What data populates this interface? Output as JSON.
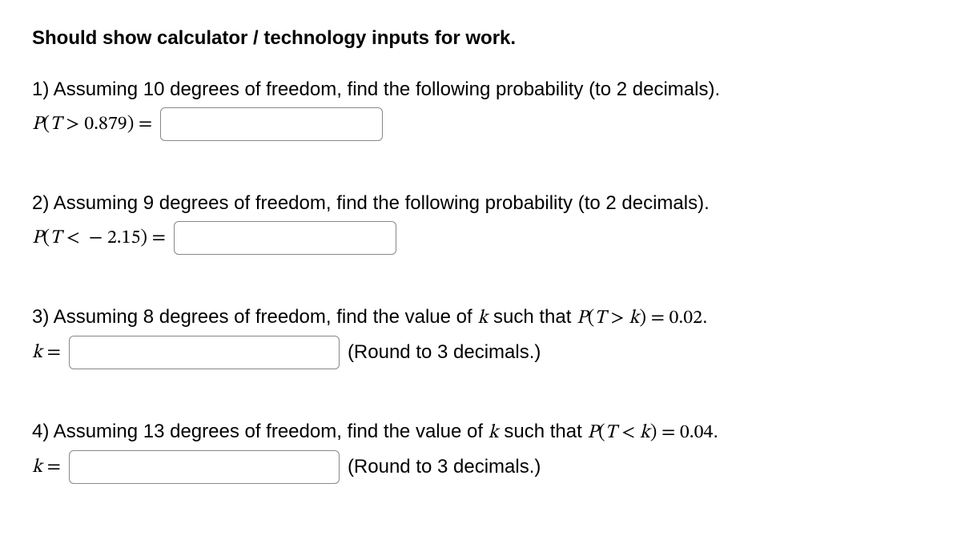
{
  "heading": "Should show calculator / technology inputs for work.",
  "q1": {
    "prompt_prefix": "1) Assuming 10 degrees of freedom, find the following probability (to 2 decimals).",
    "expr_P": "P",
    "expr_open": "(",
    "expr_T": "T",
    "expr_op": ">",
    "expr_val": "0.879",
    "expr_close": ")",
    "expr_eq": "="
  },
  "q2": {
    "prompt_prefix": "2) Assuming 9 degrees of freedom, find the following probability (to 2 decimals).",
    "expr_P": "P",
    "expr_open": "(",
    "expr_T": "T",
    "expr_op": "<",
    "expr_neg": "−",
    "expr_val": "2.15",
    "expr_close": ")",
    "expr_eq": "="
  },
  "q3": {
    "prompt_prefix": "3) Assuming 8 degrees of freedom, find the value of ",
    "prompt_k": "k",
    "prompt_mid": " such that ",
    "expr_P": "P",
    "expr_open": "(",
    "expr_T": "T",
    "expr_op": ">",
    "expr_k": "k",
    "expr_close": ")",
    "expr_eq": "=",
    "expr_rhs": "0.02",
    "prompt_end": ".",
    "ans_k": "k",
    "ans_eq": "=",
    "hint": "(Round to 3 decimals.)"
  },
  "q4": {
    "prompt_prefix": "4) Assuming 13 degrees of freedom, find the value of ",
    "prompt_k": "k",
    "prompt_mid": " such that ",
    "expr_P": "P",
    "expr_open": "(",
    "expr_T": "T",
    "expr_op": "<",
    "expr_k": "k",
    "expr_close": ")",
    "expr_eq": "=",
    "expr_rhs": "0.04",
    "prompt_end": ".",
    "ans_k": "k",
    "ans_eq": "=",
    "hint": "(Round to 3 decimals.)"
  }
}
